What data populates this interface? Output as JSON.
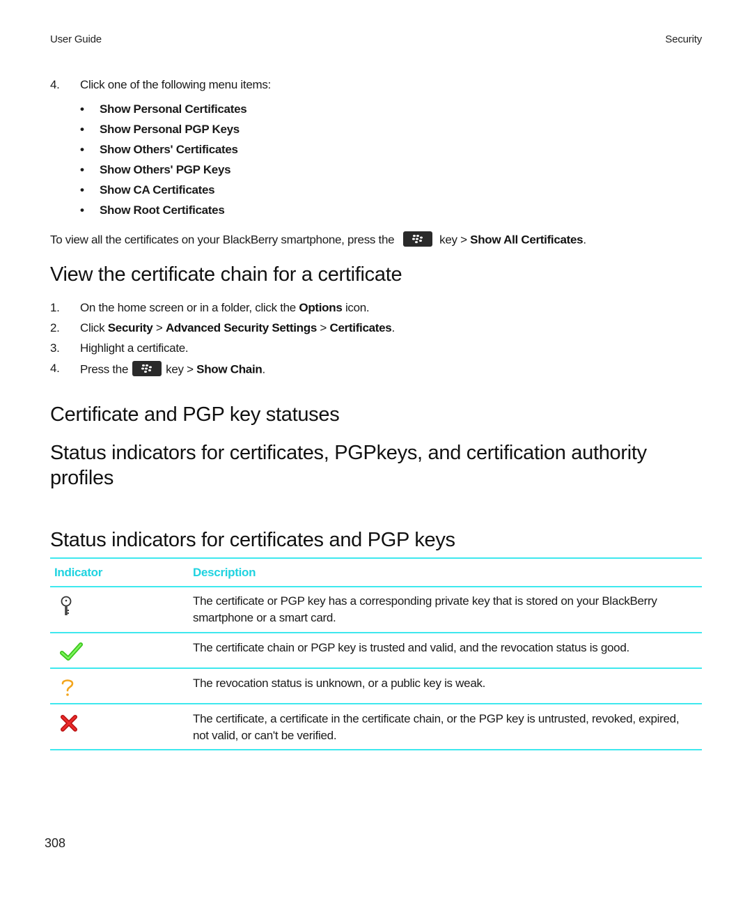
{
  "header": {
    "left": "User Guide",
    "right": "Security"
  },
  "intro_step": {
    "number": "4.",
    "text": "Click one of the following menu items:",
    "menu_items": [
      "Show Personal Certificates",
      "Show Personal PGP Keys",
      "Show Others' Certificates",
      "Show Others' PGP Keys",
      "Show CA Certificates",
      "Show Root Certificates"
    ]
  },
  "view_all": {
    "prefix": "To view all the certificates on your BlackBerry smartphone, press the",
    "key_suffix": "key >",
    "command": "Show All Certificates",
    "end": "."
  },
  "section_chain": {
    "title": "View the certificate chain for a certificate",
    "steps": [
      {
        "number": "1.",
        "pre": "On the home screen or in a folder, click the ",
        "bold": "Options",
        "post": " icon."
      },
      {
        "number": "2.",
        "pre": "Click ",
        "bold1": "Security",
        "sep1": " > ",
        "bold2": "Advanced Security Settings",
        "sep2": " > ",
        "bold3": "Certificates",
        "post": "."
      },
      {
        "number": "3.",
        "text": "Highlight a certificate."
      },
      {
        "number": "4.",
        "pre": "Press the",
        "key_suffix": "key >",
        "bold": "Show Chain",
        "post": "."
      }
    ]
  },
  "section_statuses": {
    "title": "Certificate and PGP key statuses"
  },
  "section_indicators": {
    "title": "Status indicators for certificates, PGPkeys, and certification authority profiles"
  },
  "section_table": {
    "title": "Status indicators for certificates and PGP keys",
    "columns": [
      "Indicator",
      "Description"
    ],
    "rows": [
      {
        "icon": "key-icon",
        "description": "The certificate or PGP key has a corresponding private key that is stored on your BlackBerry smartphone or a smart card."
      },
      {
        "icon": "checkmark-icon",
        "description": "The certificate chain or PGP key is trusted and valid, and the revocation status is good."
      },
      {
        "icon": "question-mark-icon",
        "description": "The revocation status is unknown, or a public key is weak."
      },
      {
        "icon": "red-x-icon",
        "description": "The certificate, a certificate in the certificate chain, or the PGP key is untrusted, revoked, expired, not valid, or can't be verified."
      }
    ],
    "accent_color": "#3ee8ee",
    "header_color": "#1fd3e0"
  },
  "footer": {
    "page_number": "308"
  }
}
